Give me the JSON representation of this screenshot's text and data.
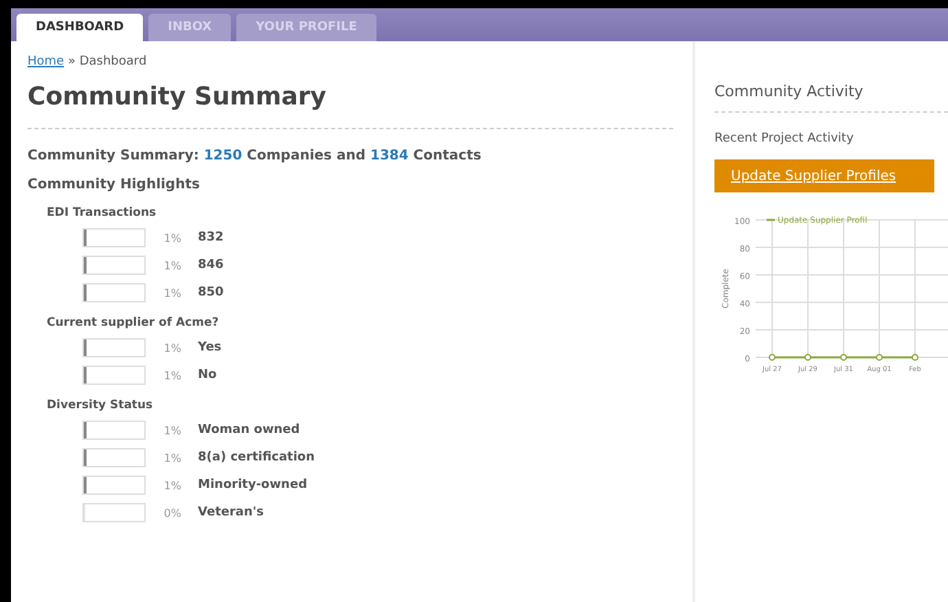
{
  "tabs": [
    {
      "label": "DASHBOARD",
      "selected": true
    },
    {
      "label": "INBOX",
      "selected": false
    },
    {
      "label": "YOUR PROFILE",
      "selected": false
    }
  ],
  "breadcrumb": {
    "link": "Home",
    "separator": "»",
    "current": "Dashboard"
  },
  "title": "Community Summary",
  "summary": "Community Summary: **1250** Companies and **1384** Contacts",
  "highlights_title": "Community Highlights",
  "groups": [
    {
      "title": "EDI Transactions",
      "rows": [
        {
          "level": 0.01,
          "percent": "1%",
          "label": "832"
        },
        {
          "level": 0.01,
          "percent": "1%",
          "label": "846"
        },
        {
          "level": 0.01,
          "percent": "1%",
          "label": "850"
        }
      ]
    },
    {
      "title": "Current supplier of Acme?",
      "rows": [
        {
          "level": 0.01,
          "percent": "1%",
          "label": "Yes"
        },
        {
          "level": 0.01,
          "percent": "1%",
          "label": "No"
        }
      ]
    },
    {
      "title": "Diversity Status",
      "rows": [
        {
          "level": 0.01,
          "percent": "1%",
          "label": "Woman owned"
        },
        {
          "level": 0.01,
          "percent": "1%",
          "label": "8(a) certification"
        },
        {
          "level": 0.01,
          "percent": "1%",
          "label": "Minority-owned"
        },
        {
          "level": 0,
          "percent": "0%",
          "label": "Veteran's"
        }
      ]
    }
  ],
  "activity": {
    "title": "Community Activity",
    "subtitle": "Recent Project Activity",
    "project_button": "Update Supplier Profiles",
    "chart_data": {
      "type": "line",
      "grid": true,
      "ylabel": "Complete",
      "categories": [
        "Jul 27",
        "Jul 29",
        "Jul 31",
        "Aug 01",
        "Feb"
      ],
      "ylim": [
        0,
        100
      ],
      "yticks": [
        0,
        20,
        40,
        60,
        80,
        100
      ],
      "series": [
        {
          "name": "Update Supplier Profil",
          "color": "#8aa83c",
          "marker": true,
          "values": [
            0,
            0,
            0,
            0,
            0
          ]
        }
      ]
    }
  }
}
